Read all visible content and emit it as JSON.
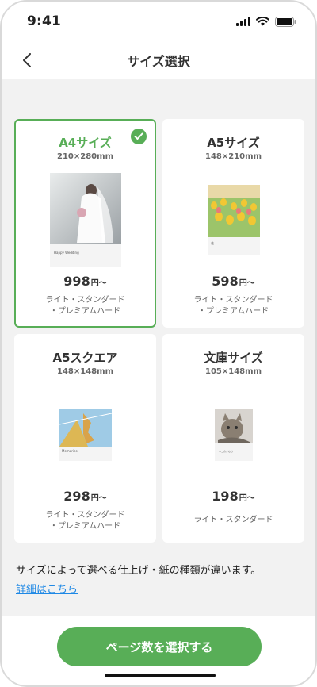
{
  "status": {
    "time": "9:41"
  },
  "nav": {
    "title": "サイズ選択"
  },
  "cards": [
    {
      "name": "A4サイズ",
      "dims": "210×280mm",
      "price": "998",
      "price_suffix": "円〜",
      "types_line1": "ライト・スタンダード",
      "types_line2": "・プレミアムハード",
      "cover_text": "Happy Wedding",
      "selected": true
    },
    {
      "name": "A5サイズ",
      "dims": "148×210mm",
      "price": "598",
      "price_suffix": "円〜",
      "types_line1": "ライト・スタンダード",
      "types_line2": "・プレミアムハード",
      "cover_text": "花",
      "selected": false
    },
    {
      "name": "A5スクエア",
      "dims": "148×148mm",
      "price": "298",
      "price_suffix": "円〜",
      "types_line1": "ライト・スタンダード",
      "types_line2": "・プレミアムハード",
      "cover_text": "Memories",
      "selected": false
    },
    {
      "name": "文庫サイズ",
      "dims": "105×148mm",
      "price": "198",
      "price_suffix": "円〜",
      "types_line1": "ライト・スタンダード",
      "types_line2": "",
      "cover_text": "ネコのきもち",
      "selected": false
    }
  ],
  "note": "サイズによって選べる仕上げ・紙の種類が違います。",
  "detail_link": "詳細はこちら",
  "cta": "ページ数を選択する",
  "colors": {
    "accent": "#58ae57",
    "link": "#1e88e5",
    "background": "#f2f2f2"
  }
}
